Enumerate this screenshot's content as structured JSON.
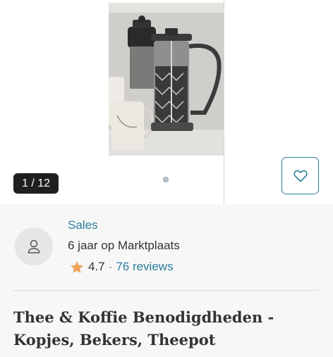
{
  "gallery": {
    "counter": "1 / 12",
    "favorite_icon": "heart-icon"
  },
  "seller": {
    "avatar_icon": "user-icon",
    "name": "Sales",
    "member_since": "6 jaar op Marktplaats",
    "rating": {
      "star_icon": "star-icon",
      "value": "4.7",
      "separator": "·",
      "reviews": "76 reviews"
    }
  },
  "listing": {
    "title": "Thee & Koffie Benodigdheden - Kopjes, Bekers, Theepot"
  },
  "colors": {
    "accent": "#2b7d9b",
    "star": "#f0a35a",
    "text": "#333333",
    "card_background": "#f7f7f7"
  }
}
